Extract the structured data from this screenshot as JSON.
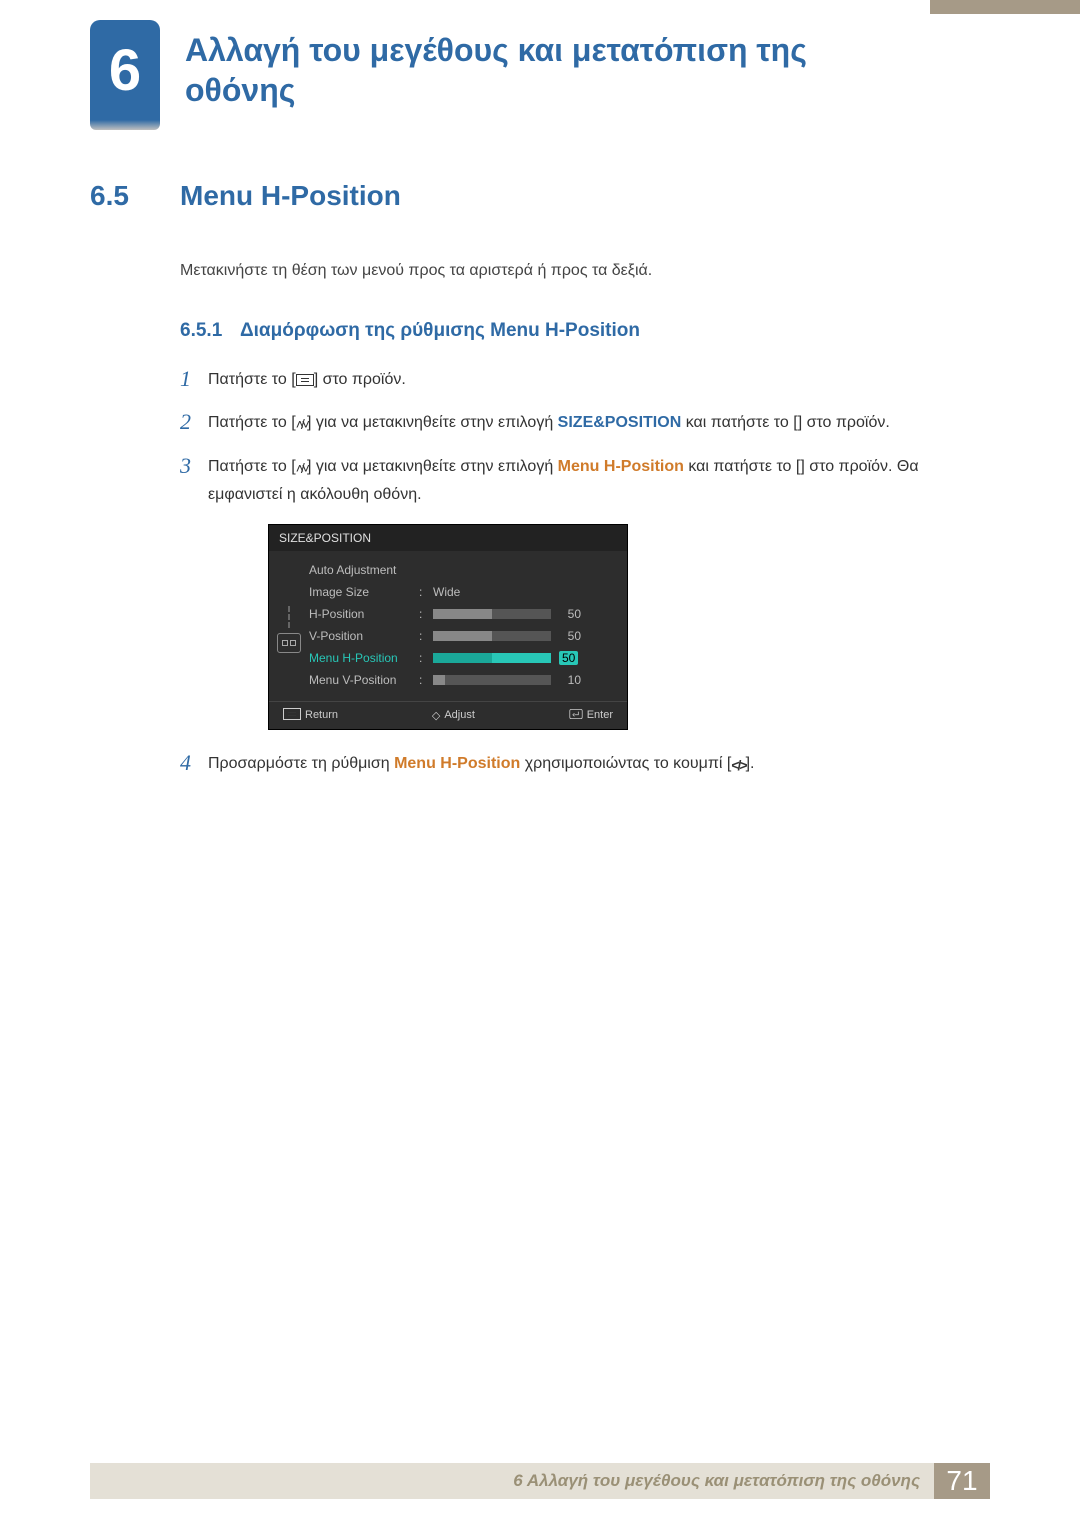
{
  "chapter": {
    "number": "6",
    "title": "Αλλαγή του μεγέθους και μετατόπιση της οθόνης"
  },
  "section": {
    "number": "6.5",
    "title": "Menu H-Position",
    "description": "Μετακινήστε τη θέση των μενού προς τα αριστερά ή προς τα δεξιά."
  },
  "subsection": {
    "number": "6.5.1",
    "title": "Διαμόρφωση της ρύθμισης Menu H-Position"
  },
  "steps": {
    "s1": {
      "num": "1",
      "t1": "Πατήστε το [",
      "t2": "] στο προϊόν."
    },
    "s2": {
      "num": "2",
      "t1": "Πατήστε το [",
      "t2": "] για να μετακινηθείτε στην επιλογή ",
      "hl": "SIZE&POSITION",
      "t3": " και πατήστε το [",
      "t4": "] στο προϊόν."
    },
    "s3": {
      "num": "3",
      "t1": "Πατήστε το [",
      "t2": "] για να μετακινηθείτε στην επιλογή ",
      "hl": "Menu H-Position",
      "t3": " και πατήστε το [",
      "t4": "] στο προϊόν. Θα εμφανιστεί η ακόλουθη οθόνη."
    },
    "s4": {
      "num": "4",
      "t1": "Προσαρμόστε τη ρύθμιση ",
      "hl": "Menu H-Position",
      "t2": " χρησιμοποιώντας το κουμπί [",
      "t3": "]."
    }
  },
  "osd": {
    "title": "SIZE&POSITION",
    "rows": {
      "auto": {
        "label": "Auto Adjustment"
      },
      "size": {
        "label": "Image Size",
        "value": "Wide"
      },
      "hpos": {
        "label": "H-Position",
        "value": "50",
        "pct": 50
      },
      "vpos": {
        "label": "V-Position",
        "value": "50",
        "pct": 50
      },
      "mhpos": {
        "label": "Menu H-Position",
        "value": "50",
        "pct": 50
      },
      "mvpos": {
        "label": "Menu V-Position",
        "value": "10",
        "pct": 10
      }
    },
    "footer": {
      "return": "Return",
      "adjust": "Adjust",
      "enter": "Enter"
    }
  },
  "footer": {
    "text": "6 Αλλαγή του μεγέθους και μετατόπιση της οθόνης",
    "page": "71"
  }
}
